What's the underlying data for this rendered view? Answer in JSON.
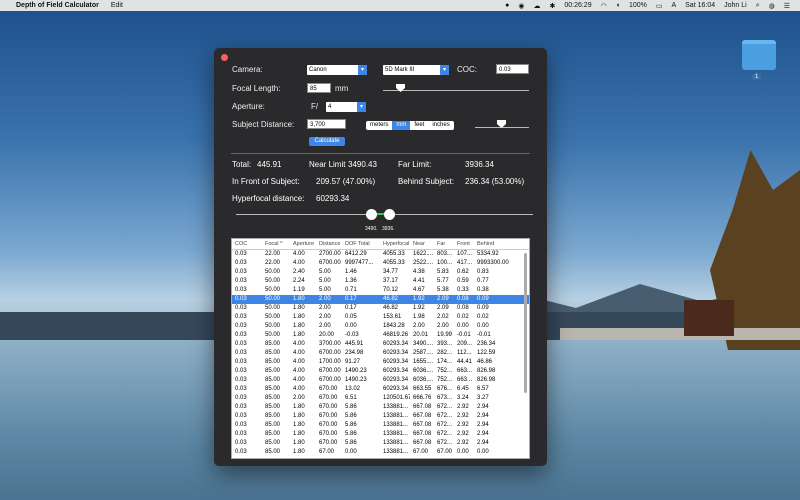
{
  "menubar": {
    "app_name": "Depth of Field Calculator",
    "menus": [
      "Edit"
    ],
    "time": "00:26:29",
    "battery": "100%",
    "datetime": "Sat 16:04",
    "user": "John Li"
  },
  "desktop": {
    "folder_label": "1"
  },
  "form": {
    "camera_label": "Camera:",
    "camera_brand": "Canon",
    "camera_model": "5D Mark III",
    "coc_label": "COC:",
    "coc_value": "0.03",
    "focal_label": "Focal Length:",
    "focal_value": "85",
    "focal_unit": "mm",
    "aperture_label": "Aperture:",
    "aperture_prefix": "F/",
    "aperture_value": "4",
    "subject_label": "Subject Distance:",
    "subject_value": "3,700",
    "units": [
      "meters",
      "mm",
      "feet",
      "inches"
    ],
    "selected_unit": "mm",
    "calculate_label": "Calculate"
  },
  "results": {
    "total_label": "Total:",
    "total_value": "445.91",
    "near_label": "Near Limit",
    "near_value": "3490.43",
    "far_label": "Far Limit:",
    "far_value": "3936.34",
    "front_label": "In Front of Subject:",
    "front_value": "209.57 (47.00%)",
    "behind_label": "Behind Subject:",
    "behind_value": "236.34 (53.00%)",
    "hyper_label": "Hyperfocal distance:",
    "hyper_value": "60293.34",
    "knob_near_label": "3490.",
    "knob_far_label": "3936."
  },
  "table": {
    "headers": [
      "COC",
      "Focal",
      "Aperture",
      "Distance",
      "DOF Total",
      "Hyperfocal",
      "Near",
      "Far",
      "Front",
      "Behind"
    ],
    "sort_indicator": "^",
    "selected_row": 5,
    "rows": [
      [
        "0.03",
        "22.00",
        "4.00",
        "2700.00",
        "6412.29",
        "4055.33",
        "1622....",
        "803...",
        "107...",
        "5334.92"
      ],
      [
        "0.03",
        "22.00",
        "4.00",
        "6700.00",
        "9997477...",
        "4055.33",
        "2522....",
        "100...",
        "417...",
        "9993300.00"
      ],
      [
        "0.03",
        "50.00",
        "2.40",
        "5.00",
        "1.46",
        "34.77",
        "4.38",
        "5.83",
        "0.62",
        "0.83"
      ],
      [
        "0.03",
        "50.00",
        "2.24",
        "5.00",
        "1.36",
        "37.17",
        "4.41",
        "5.77",
        "0.59",
        "0.77"
      ],
      [
        "0.03",
        "50.00",
        "1.19",
        "5.00",
        "0.71",
        "70.12",
        "4.67",
        "5.38",
        "0.33",
        "0.38"
      ],
      [
        "0.03",
        "50.00",
        "1.80",
        "2.00",
        "0.17",
        "46.82",
        "1.92",
        "2.09",
        "0.08",
        "0.09"
      ],
      [
        "0.03",
        "50.00",
        "1.80",
        "2.00",
        "0.17",
        "46.82",
        "1.92",
        "2.09",
        "0.08",
        "0.09"
      ],
      [
        "0.03",
        "50.00",
        "1.80",
        "2.00",
        "0.05",
        "153.61",
        "1.98",
        "2.02",
        "0.02",
        "0.02"
      ],
      [
        "0.03",
        "50.00",
        "1.80",
        "2.00",
        "0.00",
        "1843.28",
        "2.00",
        "2.00",
        "0.00",
        "0.00"
      ],
      [
        "0.03",
        "50.00",
        "1.80",
        "20.00",
        "-0.03",
        "46819.26",
        "20.01",
        "19.99",
        "-0.01",
        "-0.01"
      ],
      [
        "0.03",
        "85.00",
        "4.00",
        "3700.00",
        "445.91",
        "60293.34",
        "3490....",
        "393...",
        "209...",
        "236.34"
      ],
      [
        "0.03",
        "85.00",
        "4.00",
        "6700.00",
        "234.98",
        "60293.34",
        "2587....",
        "282...",
        "112...",
        "122.59"
      ],
      [
        "0.03",
        "85.00",
        "4.00",
        "1700.00",
        "91.27",
        "60293.34",
        "1655....",
        "174...",
        "44.41",
        "46.86"
      ],
      [
        "0.03",
        "85.00",
        "4.00",
        "6700.00",
        "1490.23",
        "60293.34",
        "6036....",
        "752...",
        "663...",
        "826.98"
      ],
      [
        "0.03",
        "85.00",
        "4.00",
        "6700.00",
        "1490.23",
        "60293.34",
        "6036....",
        "752...",
        "663...",
        "826.98"
      ],
      [
        "0.03",
        "85.00",
        "4.00",
        "670.00",
        "13.02",
        "60293.34",
        "663.55",
        "676...",
        "6.45",
        "6.57"
      ],
      [
        "0.03",
        "85.00",
        "2.00",
        "670.00",
        "6.51",
        "120501.67",
        "666.76",
        "673...",
        "3.24",
        "3.27"
      ],
      [
        "0.03",
        "85.00",
        "1.80",
        "670.00",
        "5.86",
        "133881...",
        "667.08",
        "672...",
        "2.92",
        "2.94"
      ],
      [
        "0.03",
        "85.00",
        "1.80",
        "670.00",
        "5.86",
        "133881...",
        "667.08",
        "672...",
        "2.92",
        "2.94"
      ],
      [
        "0.03",
        "85.00",
        "1.80",
        "670.00",
        "5.86",
        "133881...",
        "667.08",
        "672...",
        "2.92",
        "2.94"
      ],
      [
        "0.03",
        "85.00",
        "1.80",
        "670.00",
        "5.86",
        "133881...",
        "667.08",
        "672...",
        "2.92",
        "2.94"
      ],
      [
        "0.03",
        "85.00",
        "1.80",
        "670.00",
        "5.86",
        "133881...",
        "667.08",
        "672...",
        "2.92",
        "2.94"
      ],
      [
        "0.03",
        "85.00",
        "1.80",
        "67.00",
        "0.00",
        "133881...",
        "67.00",
        "67.00",
        "0.00",
        "0.00"
      ],
      [
        "0.03",
        "85.00",
        "1.80",
        "67.00",
        "0.00",
        "133881...",
        "67.00",
        "67.00",
        "0.00",
        "0.00"
      ]
    ]
  }
}
